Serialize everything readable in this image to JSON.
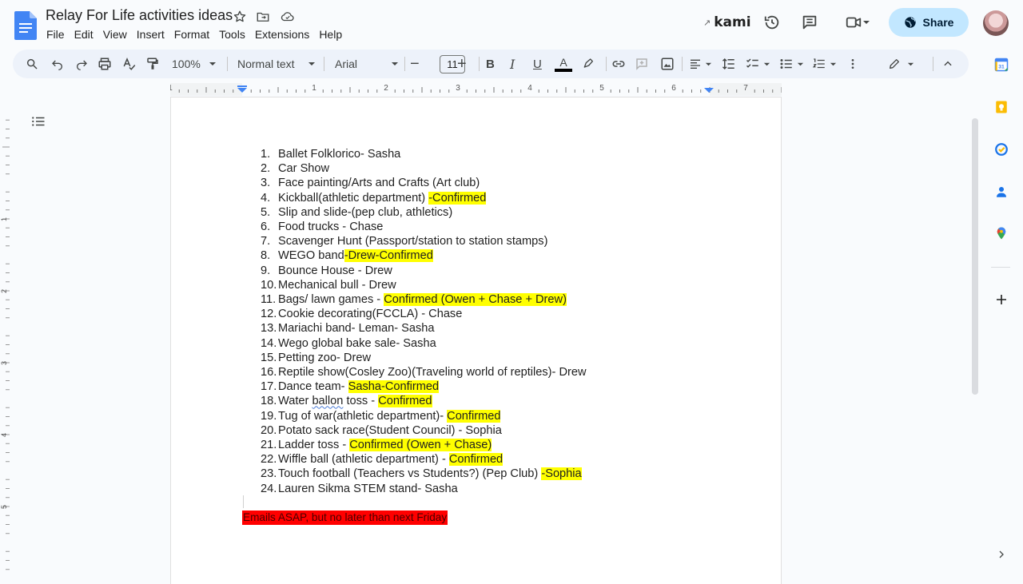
{
  "header": {
    "title": "Relay For Life activities ideas",
    "menu": [
      "File",
      "Edit",
      "View",
      "Insert",
      "Format",
      "Tools",
      "Extensions",
      "Help"
    ],
    "kami_label": "kami",
    "share_label": "Share"
  },
  "toolbar": {
    "zoom": "100%",
    "style": "Normal text",
    "font": "Arial",
    "font_size": "11"
  },
  "ruler": {
    "marks": [
      "1",
      "1",
      "2",
      "3",
      "4",
      "5",
      "6",
      "7"
    ]
  },
  "left_ruler": {
    "marks": [
      "1",
      "2",
      "3",
      "4",
      "5"
    ]
  },
  "document": {
    "items": [
      {
        "n": "1.",
        "text": "Ballet Folklorico- Sasha",
        "hl": ""
      },
      {
        "n": "2.",
        "text": "Car Show",
        "hl": ""
      },
      {
        "n": "3.",
        "text": "Face painting/Arts and Crafts (Art club)",
        "hl": ""
      },
      {
        "n": "4.",
        "text": "Kickball(athletic department) ",
        "hl": "-Confirmed"
      },
      {
        "n": "5.",
        "text": "Slip and slide-(pep club, athletics)",
        "hl": ""
      },
      {
        "n": "6.",
        "text": "Food trucks - Chase",
        "hl": ""
      },
      {
        "n": "7.",
        "text": "Scavenger Hunt (Passport/station to station stamps)",
        "hl": ""
      },
      {
        "n": "8.",
        "text": "WEGO band",
        "hl": "-Drew-Confirmed"
      },
      {
        "n": "9.",
        "text": "Bounce House - Drew",
        "hl": ""
      },
      {
        "n": "10.",
        "text": "Mechanical bull - Drew",
        "hl": ""
      },
      {
        "n": "11.",
        "text": "Bags/ lawn games - ",
        "hl": "Confirmed (Owen + Chase + Drew)"
      },
      {
        "n": "12.",
        "text": "Cookie decorating(FCCLA) - Chase",
        "hl": ""
      },
      {
        "n": "13.",
        "text": "Mariachi band- Leman- Sasha",
        "hl": ""
      },
      {
        "n": "14.",
        "text": "Wego global bake sale- Sasha",
        "hl": ""
      },
      {
        "n": "15.",
        "text": "Petting zoo- Drew",
        "hl": ""
      },
      {
        "n": "16.",
        "text": "Reptile show(Cosley Zoo)(Traveling world of reptiles)- Drew",
        "hl": ""
      },
      {
        "n": "17.",
        "text": "Dance team- ",
        "hl": "Sasha-Confirmed"
      },
      {
        "n": "18.",
        "text_a": "Water ",
        "squiggle": "ballon",
        "text": " toss - ",
        "hl": "Confirmed"
      },
      {
        "n": "19.",
        "text": "Tug of war(athletic department)- ",
        "hl": "Confirmed"
      },
      {
        "n": "20.",
        "text": "Potato sack race(Student Council) - Sophia",
        "hl": ""
      },
      {
        "n": "21.",
        "text": "Ladder toss - ",
        "hl": "Confirmed (Owen + Chase)"
      },
      {
        "n": "22.",
        "text": "Wiffle ball (athletic department) - ",
        "hl": "Confirmed"
      },
      {
        "n": "23.",
        "text": "Touch football (Teachers vs Students?) (Pep Club) ",
        "hl": "-Sophia"
      },
      {
        "n": "24.",
        "text": "Lauren Sikma STEM stand- Sasha",
        "hl": ""
      }
    ],
    "footer_note": "Emails ASAP, but no later than next Friday"
  },
  "colors": {
    "highlight": "#ffff00",
    "note_bg": "#ff0000",
    "share_bg": "#c2e7ff",
    "docs_blue": "#4285f4"
  }
}
